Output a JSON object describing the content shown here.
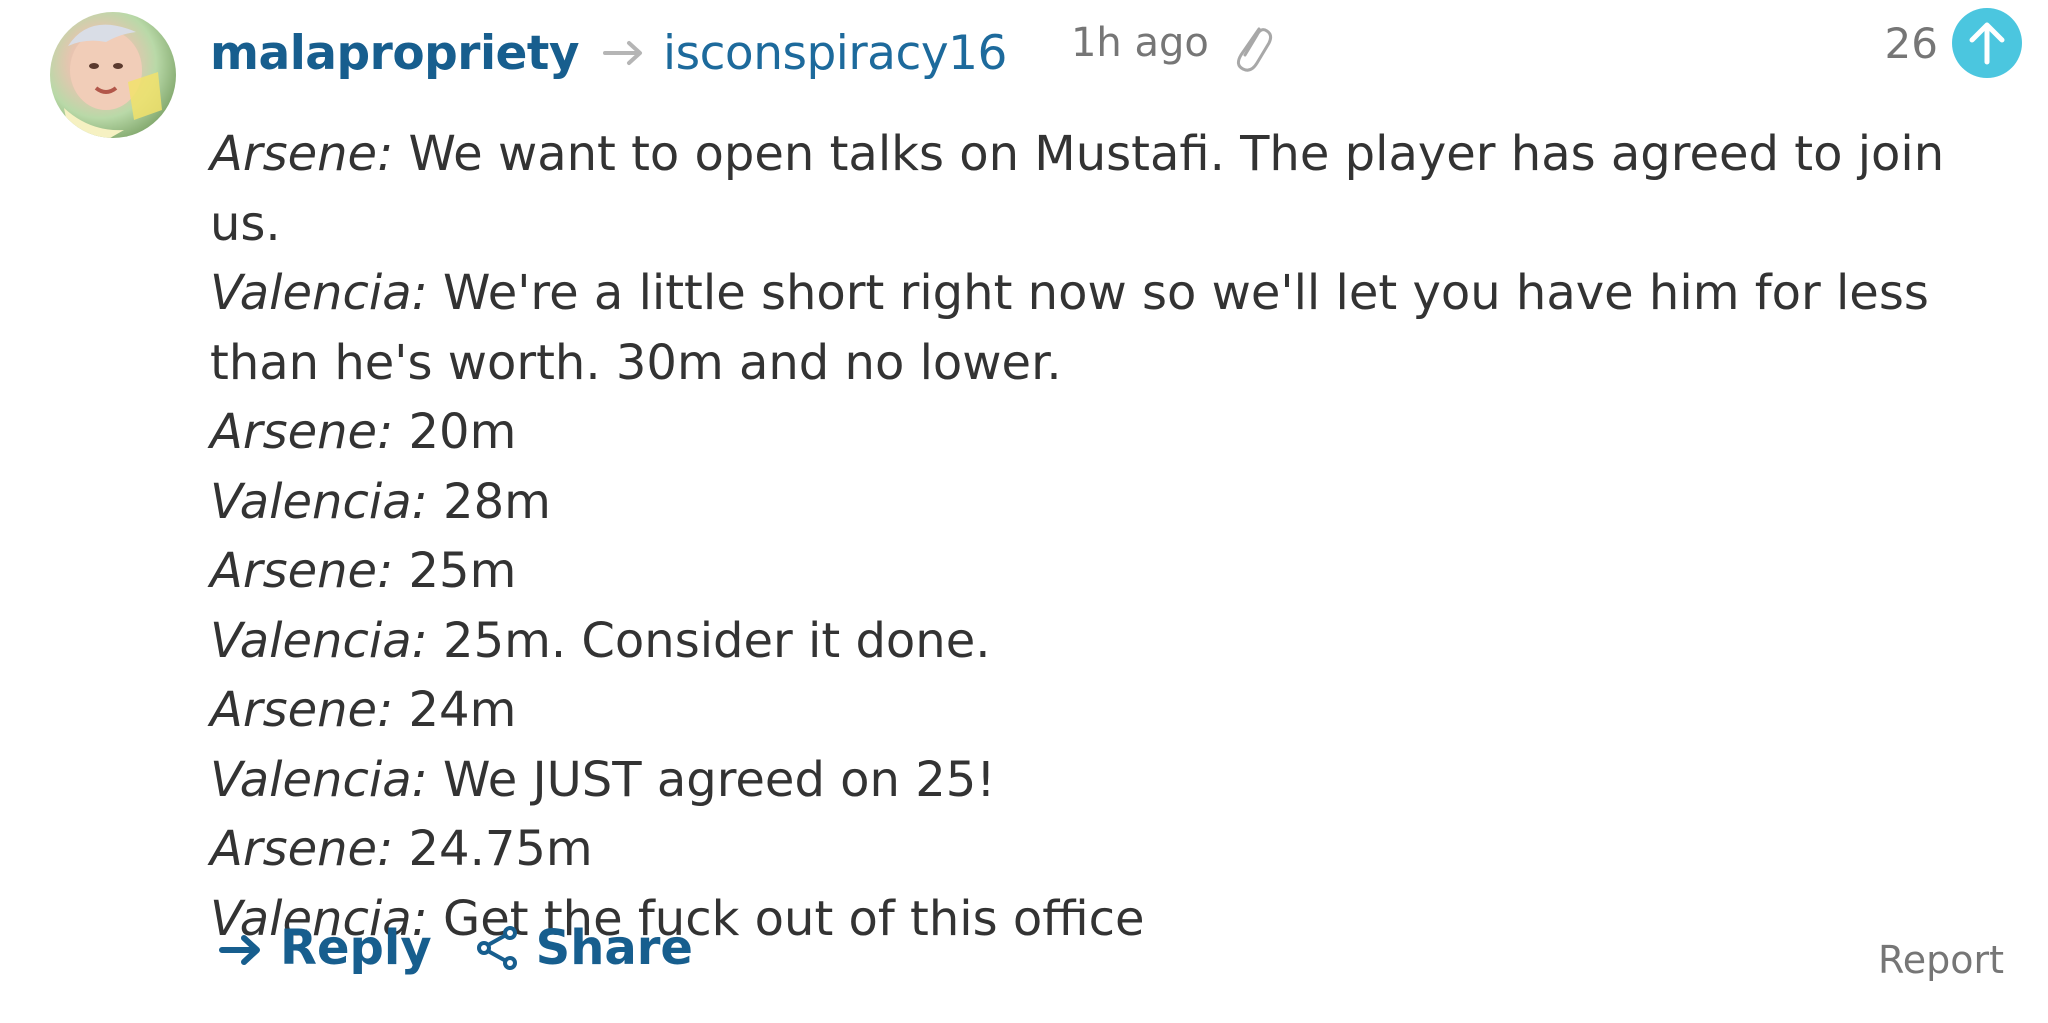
{
  "comment": {
    "author": "malapropriety",
    "reply_to": "isconspiracy16",
    "timestamp": "1h ago",
    "vote_count": "26",
    "icons": {
      "reply_arrow": "reply-arrow-icon",
      "attachment": "paperclip-icon",
      "upvote": "upvote-arrow-icon",
      "share": "share-icon"
    },
    "colors": {
      "link": "#175e8e",
      "upvote": "#4bc6df",
      "muted": "#767676",
      "text": "#333333"
    },
    "lines": [
      {
        "speaker": "Arsene:",
        "text": "We want to open talks on Mustafi. The player has agreed to join us."
      },
      {
        "speaker": "Valencia:",
        "text": "We're a little short right now so we'll let you have him for less than he's worth. 30m and no lower."
      },
      {
        "speaker": "Arsene:",
        "text": "20m"
      },
      {
        "speaker": "Valencia:",
        "text": "28m"
      },
      {
        "speaker": "Arsene:",
        "text": "25m"
      },
      {
        "speaker": "Valencia:",
        "text": "25m. Consider it done."
      },
      {
        "speaker": "Arsene:",
        "text": "24m"
      },
      {
        "speaker": "Valencia:",
        "text": "We JUST agreed on 25!"
      },
      {
        "speaker": "Arsene:",
        "text": "24.75m"
      },
      {
        "speaker": "Valencia:",
        "text": "Get the fuck out of this office"
      }
    ],
    "actions": {
      "reply": "Reply",
      "share": "Share",
      "report": "Report"
    }
  }
}
